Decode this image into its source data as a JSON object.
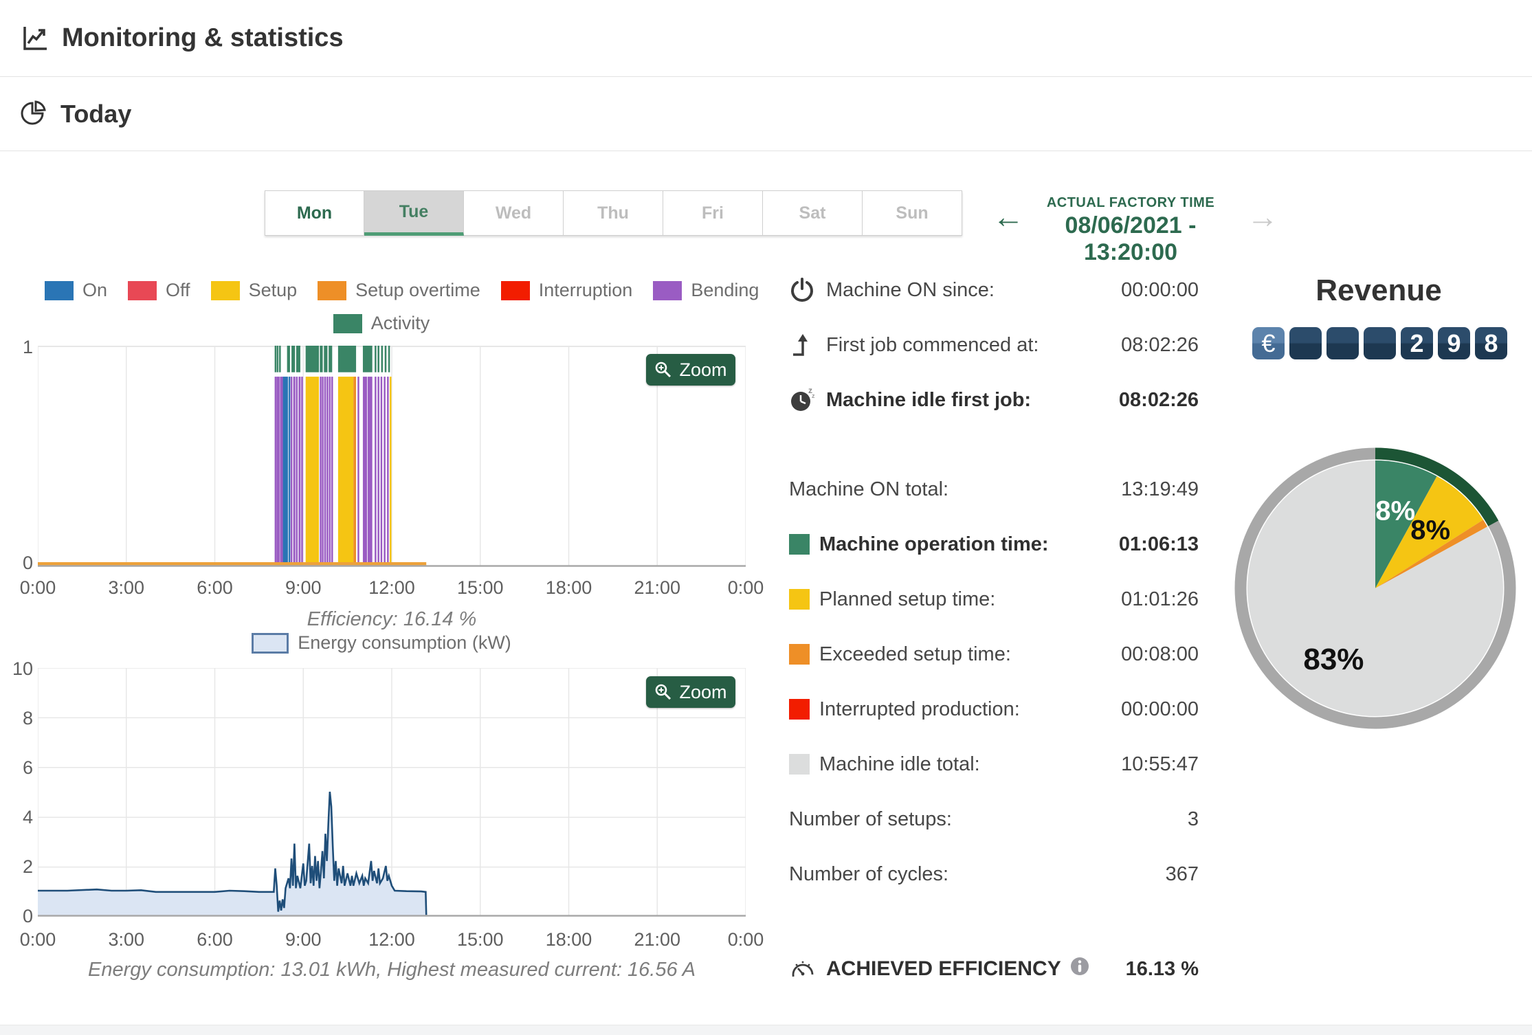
{
  "header": {
    "title": "Monitoring & statistics"
  },
  "section": {
    "title": "Today"
  },
  "tabs": {
    "days": [
      "Mon",
      "Tue",
      "Wed",
      "Thu",
      "Fri",
      "Sat",
      "Sun"
    ],
    "selected": "Tue"
  },
  "factory_time": {
    "label": "ACTUAL FACTORY TIME",
    "value": "08/06/2021 - 13:20:00"
  },
  "ui": {
    "zoom_button": "Zoom",
    "prev_arrow": "←",
    "next_arrow": "→"
  },
  "colors": {
    "accent_green": "#2d6a4f",
    "button_green": "#275d44",
    "ring_green": "#1c5535",
    "on_blue": "#2a75b5",
    "off_red": "#e84855",
    "setup_yellow": "#f5c513",
    "setup_overtime_orange": "#ee8f27",
    "interruption_red": "#f21d00",
    "bending_purple": "#9a5cc3",
    "activity_green": "#3a8566",
    "idle_gray": "#dcdddd",
    "energy_fill": "#dbe5f3",
    "energy_line": "#1f4e79",
    "baseline_orange": "#eda13a"
  },
  "legend": {
    "row1": [
      {
        "label": "On",
        "swatch_style": "background:#2a75b5"
      },
      {
        "label": "Off",
        "swatch_style": "background:#e84855"
      },
      {
        "label": "Setup",
        "swatch_style": "background:#f5c513"
      },
      {
        "label": "Setup overtime",
        "swatch_style": "background:#ee8f27"
      },
      {
        "label": "Interruption",
        "swatch_style": "background:#f21d00"
      },
      {
        "label": "Bending",
        "swatch_style": "background:#9a5cc3"
      }
    ],
    "row2": [
      {
        "label": "Activity",
        "swatch_style": "background:#3a8566"
      }
    ],
    "energy": {
      "label": "Energy consumption (kW)",
      "swatch_style": "background:#dbe5f3;border-color:#5b7ca6"
    }
  },
  "stats": {
    "rows": [
      {
        "label": "Machine ON since:",
        "value": "00:00:00",
        "icon": "power-icon"
      },
      {
        "label": "First job commenced at:",
        "value": "08:02:26",
        "icon": "first-job-icon"
      },
      {
        "label": "Machine idle first job:",
        "value": "08:02:26",
        "icon": "idle-clock-icon",
        "bold": true
      },
      {
        "label": "Machine ON total:",
        "value": "13:19:49"
      },
      {
        "label": "Machine operation time:",
        "value": "01:06:13",
        "bold": true,
        "swatch_style": "background:#3a8566"
      },
      {
        "label": "Planned setup time:",
        "value": "01:01:26",
        "swatch_style": "background:#f5c513"
      },
      {
        "label": "Exceeded setup time:",
        "value": "00:08:00",
        "swatch_style": "background:#ee8f27"
      },
      {
        "label": "Interrupted production:",
        "value": "00:00:00",
        "swatch_style": "background:#f21d00"
      },
      {
        "label": "Machine idle total:",
        "value": "10:55:47",
        "swatch_style": "background:#dcdddd"
      },
      {
        "label": "Number of setups:",
        "value": "3"
      },
      {
        "label": "Number of cycles:",
        "value": "367"
      }
    ],
    "efficiency": {
      "label": "ACHIEVED EFFICIENCY",
      "value": "16.13 %"
    }
  },
  "revenue": {
    "title": "Revenue",
    "currency": "€",
    "digits": [
      "",
      "",
      "",
      "2",
      "9",
      "8"
    ]
  },
  "chart_data": [
    {
      "type": "bar",
      "name": "machine-status-timeline",
      "title": "",
      "xlabel": "",
      "ylabel": "",
      "ylim": [
        0,
        1
      ],
      "xlim_hours": [
        0,
        24
      ],
      "yticks": [
        "1",
        "0"
      ],
      "xticks": [
        "0:00",
        "3:00",
        "6:00",
        "9:00",
        "12:00",
        "15:00",
        "18:00",
        "21:00",
        "0:00"
      ],
      "caption": "Efficiency: 16.14 %",
      "status_band": [
        0,
        0.86
      ],
      "activity_band": [
        0.88,
        1.0
      ],
      "baseline": {
        "color_key": "baseline_orange",
        "start_h": 0,
        "end_h": 13.17
      },
      "status_segments": [
        {
          "start_h": 8.03,
          "dur_h": 0.045,
          "color_key": "bending_purple"
        },
        {
          "start_h": 8.09,
          "dur_h": 0.03,
          "color_key": "bending_purple"
        },
        {
          "start_h": 8.14,
          "dur_h": 0.05,
          "color_key": "bending_purple"
        },
        {
          "start_h": 8.21,
          "dur_h": 0.03,
          "color_key": "bending_purple"
        },
        {
          "start_h": 8.26,
          "dur_h": 0.04,
          "color_key": "bending_purple"
        },
        {
          "start_h": 8.31,
          "dur_h": 0.17,
          "color_key": "on_blue"
        },
        {
          "start_h": 8.5,
          "dur_h": 0.05,
          "color_key": "on_blue"
        },
        {
          "start_h": 8.57,
          "dur_h": 0.06,
          "color_key": "bending_purple"
        },
        {
          "start_h": 8.66,
          "dur_h": 0.07,
          "color_key": "bending_purple"
        },
        {
          "start_h": 8.75,
          "dur_h": 0.06,
          "color_key": "bending_purple"
        },
        {
          "start_h": 8.84,
          "dur_h": 0.07,
          "color_key": "bending_purple"
        },
        {
          "start_h": 8.93,
          "dur_h": 0.05,
          "color_key": "bending_purple"
        },
        {
          "start_h": 9.08,
          "dur_h": 0.45,
          "color_key": "setup_yellow"
        },
        {
          "start_h": 9.56,
          "dur_h": 0.05,
          "color_key": "bending_purple"
        },
        {
          "start_h": 9.63,
          "dur_h": 0.05,
          "color_key": "bending_purple"
        },
        {
          "start_h": 9.71,
          "dur_h": 0.06,
          "color_key": "bending_purple"
        },
        {
          "start_h": 9.79,
          "dur_h": 0.05,
          "color_key": "bending_purple"
        },
        {
          "start_h": 9.87,
          "dur_h": 0.06,
          "color_key": "bending_purple"
        },
        {
          "start_h": 9.95,
          "dur_h": 0.04,
          "color_key": "bending_purple"
        },
        {
          "start_h": 10.18,
          "dur_h": 0.52,
          "color_key": "setup_yellow"
        },
        {
          "start_h": 10.7,
          "dur_h": 0.09,
          "color_key": "setup_overtime_orange"
        },
        {
          "start_h": 10.84,
          "dur_h": 0.035,
          "color_key": "bending_purple"
        },
        {
          "start_h": 11.02,
          "dur_h": 0.14,
          "color_key": "bending_purple"
        },
        {
          "start_h": 11.18,
          "dur_h": 0.16,
          "color_key": "bending_purple"
        },
        {
          "start_h": 11.42,
          "dur_h": 0.025,
          "color_key": "bending_purple"
        },
        {
          "start_h": 11.52,
          "dur_h": 0.025,
          "color_key": "bending_purple"
        },
        {
          "start_h": 11.62,
          "dur_h": 0.025,
          "color_key": "bending_purple"
        },
        {
          "start_h": 11.73,
          "dur_h": 0.025,
          "color_key": "bending_purple"
        },
        {
          "start_h": 11.84,
          "dur_h": 0.025,
          "color_key": "bending_purple"
        },
        {
          "start_h": 11.93,
          "dur_h": 0.05,
          "color_key": "setup_yellow"
        }
      ],
      "activity_segments": [
        {
          "start_h": 8.03,
          "dur_h": 0.04
        },
        {
          "start_h": 8.1,
          "dur_h": 0.04
        },
        {
          "start_h": 8.18,
          "dur_h": 0.05
        },
        {
          "start_h": 8.45,
          "dur_h": 0.1
        },
        {
          "start_h": 8.6,
          "dur_h": 0.12
        },
        {
          "start_h": 8.76,
          "dur_h": 0.14
        },
        {
          "start_h": 9.08,
          "dur_h": 0.45
        },
        {
          "start_h": 9.56,
          "dur_h": 0.1
        },
        {
          "start_h": 9.7,
          "dur_h": 0.12
        },
        {
          "start_h": 9.86,
          "dur_h": 0.12
        },
        {
          "start_h": 10.18,
          "dur_h": 0.61
        },
        {
          "start_h": 11.02,
          "dur_h": 0.32
        },
        {
          "start_h": 11.42,
          "dur_h": 0.05
        },
        {
          "start_h": 11.52,
          "dur_h": 0.06
        },
        {
          "start_h": 11.64,
          "dur_h": 0.06
        },
        {
          "start_h": 11.76,
          "dur_h": 0.06
        },
        {
          "start_h": 11.88,
          "dur_h": 0.05
        }
      ]
    },
    {
      "type": "area",
      "name": "energy-consumption",
      "legend": "Energy consumption (kW)",
      "ylim": [
        0,
        10
      ],
      "xlim_hours": [
        0,
        24
      ],
      "yticks": [
        "10",
        "8",
        "6",
        "4",
        "2",
        "0"
      ],
      "xticks": [
        "0:00",
        "3:00",
        "6:00",
        "9:00",
        "12:00",
        "15:00",
        "18:00",
        "21:00",
        "0:00"
      ],
      "caption": "Energy consumption: 13.01 kWh, Highest measured current: 16.56 A",
      "points": [
        [
          0,
          1.0
        ],
        [
          1,
          1.0
        ],
        [
          2,
          1.05
        ],
        [
          2.5,
          1.0
        ],
        [
          3,
          1.0
        ],
        [
          3.5,
          1.02
        ],
        [
          4,
          0.95
        ],
        [
          5,
          0.95
        ],
        [
          6,
          0.95
        ],
        [
          6.5,
          1.0
        ],
        [
          7,
          0.98
        ],
        [
          7.5,
          0.95
        ],
        [
          8.0,
          0.95
        ],
        [
          8.05,
          1.9
        ],
        [
          8.1,
          1.2
        ],
        [
          8.15,
          0.15
        ],
        [
          8.2,
          0.6
        ],
        [
          8.25,
          0.2
        ],
        [
          8.3,
          0.65
        ],
        [
          8.35,
          0.3
        ],
        [
          8.4,
          1.1
        ],
        [
          8.5,
          1.5
        ],
        [
          8.55,
          1.1
        ],
        [
          8.6,
          2.3
        ],
        [
          8.65,
          1.2
        ],
        [
          8.7,
          2.9
        ],
        [
          8.75,
          1.1
        ],
        [
          8.8,
          1.6
        ],
        [
          8.9,
          1.1
        ],
        [
          9.0,
          2.1
        ],
        [
          9.05,
          1.2
        ],
        [
          9.1,
          1.4
        ],
        [
          9.2,
          2.9
        ],
        [
          9.25,
          1.3
        ],
        [
          9.3,
          2.0
        ],
        [
          9.35,
          1.2
        ],
        [
          9.4,
          2.4
        ],
        [
          9.45,
          1.4
        ],
        [
          9.5,
          2.2
        ],
        [
          9.55,
          1.1
        ],
        [
          9.6,
          1.8
        ],
        [
          9.65,
          2.6
        ],
        [
          9.7,
          1.5
        ],
        [
          9.75,
          3.3
        ],
        [
          9.8,
          2.2
        ],
        [
          9.85,
          3.7
        ],
        [
          9.9,
          5.0
        ],
        [
          9.95,
          4.4
        ],
        [
          10.0,
          2.8
        ],
        [
          10.05,
          1.4
        ],
        [
          10.1,
          2.2
        ],
        [
          10.15,
          1.2
        ],
        [
          10.2,
          1.9
        ],
        [
          10.3,
          1.3
        ],
        [
          10.35,
          2.0
        ],
        [
          10.4,
          1.2
        ],
        [
          10.5,
          1.7
        ],
        [
          10.6,
          1.2
        ],
        [
          10.65,
          1.6
        ],
        [
          10.7,
          1.2
        ],
        [
          10.8,
          1.7
        ],
        [
          10.9,
          1.3
        ],
        [
          11.0,
          1.6
        ],
        [
          11.05,
          1.2
        ],
        [
          11.1,
          1.5
        ],
        [
          11.2,
          1.3
        ],
        [
          11.3,
          2.2
        ],
        [
          11.35,
          1.4
        ],
        [
          11.4,
          1.8
        ],
        [
          11.5,
          1.3
        ],
        [
          11.55,
          1.9
        ],
        [
          11.6,
          1.3
        ],
        [
          11.7,
          1.5
        ],
        [
          11.8,
          2.0
        ],
        [
          11.85,
          1.4
        ],
        [
          11.9,
          1.6
        ],
        [
          12.0,
          1.2
        ],
        [
          12.1,
          1.0
        ],
        [
          12.5,
          0.98
        ],
        [
          13.0,
          0.97
        ],
        [
          13.15,
          0.95
        ],
        [
          13.17,
          0.02
        ]
      ]
    },
    {
      "type": "pie",
      "name": "machine-time-distribution",
      "slices": [
        {
          "label": "8%",
          "value": 8,
          "color_key": "activity_green",
          "label_color": "#ffffff",
          "label_r": 0.63,
          "label_size": 40
        },
        {
          "label": "8%",
          "value": 8,
          "color_key": "setup_yellow",
          "label_color": "#111111",
          "label_r": 0.63,
          "label_size": 40
        },
        {
          "label": "",
          "value": 1,
          "color_key": "setup_overtime_orange"
        },
        {
          "label": "83%",
          "value": 83,
          "color_key": "idle_gray",
          "label_color": "#111111",
          "label_r": 0.64,
          "label_size": 44
        }
      ],
      "ring_highlight_slices": 3,
      "legend_position": "none"
    }
  ]
}
